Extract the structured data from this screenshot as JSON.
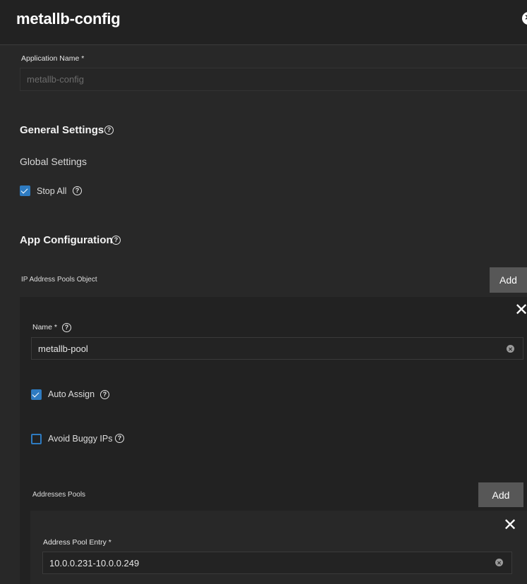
{
  "header": {
    "title": "metallb-config"
  },
  "application": {
    "label": "Application Name *",
    "value": "metallb-config"
  },
  "general_settings": {
    "title": "General Settings",
    "global_settings_title": "Global Settings",
    "stop_all": {
      "label": "Stop All",
      "checked": true
    }
  },
  "app_configuration": {
    "title": "App Configuration",
    "ip_pools_label": "IP Address Pools Object",
    "add_label": "Add",
    "pool": {
      "name_label": "Name *",
      "name_value": "metallb-pool",
      "auto_assign": {
        "label": "Auto Assign",
        "checked": true
      },
      "avoid_buggy_ips": {
        "label": "Avoid Buggy IPs",
        "checked": false
      },
      "addresses_pools_label": "Addresses Pools",
      "add_label": "Add",
      "entry": {
        "label": "Address Pool Entry *",
        "value": "10.0.0.231-10.0.0.249"
      }
    }
  },
  "colors": {
    "accent": "#2e7bc1",
    "background": "#282828",
    "panel": "#222222",
    "button": "#575757"
  }
}
